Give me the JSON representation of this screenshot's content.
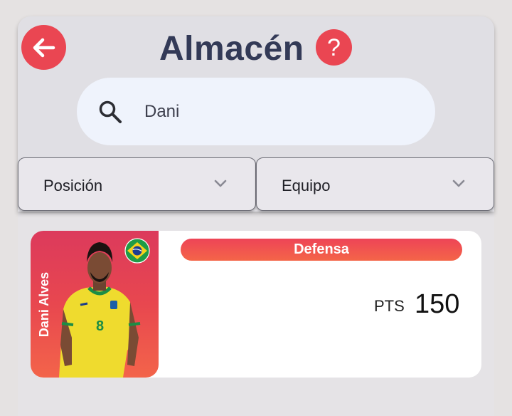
{
  "header": {
    "title": "Almacén",
    "back_icon": "arrow-left-icon",
    "help_icon": "question-icon",
    "help_symbol": "?",
    "accent_color": "#ea4652",
    "title_color": "#333a57"
  },
  "search": {
    "value": "Dani",
    "icon": "search-icon"
  },
  "filters": [
    {
      "label": "Posición",
      "icon": "chevron-down-icon"
    },
    {
      "label": "Equipo",
      "icon": "chevron-down-icon"
    }
  ],
  "player_card": {
    "name": "Dani Alves",
    "position": "Defensa",
    "pts_label": "PTS",
    "pts_value": "150",
    "flag_icon": "brazil-flag-icon",
    "card_gradient": [
      "#dc3a5c",
      "#f3644a"
    ]
  }
}
